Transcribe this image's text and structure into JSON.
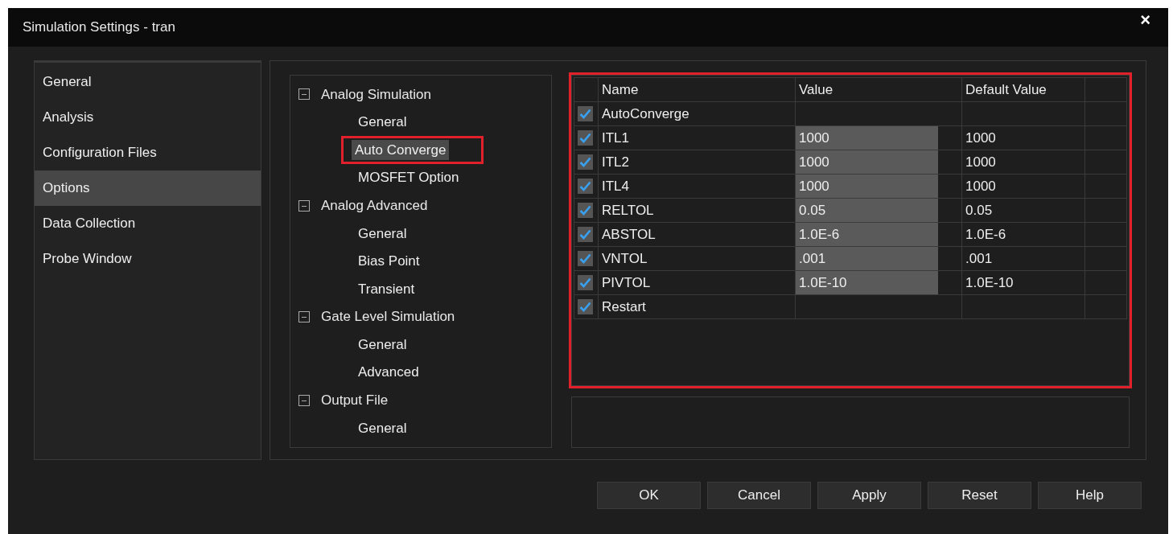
{
  "window": {
    "title": "Simulation Settings - tran",
    "close": "×"
  },
  "sidebar": {
    "items": [
      {
        "label": "General",
        "selected": false
      },
      {
        "label": "Analysis",
        "selected": false
      },
      {
        "label": "Configuration Files",
        "selected": false
      },
      {
        "label": "Options",
        "selected": true
      },
      {
        "label": "Data Collection",
        "selected": false
      },
      {
        "label": "Probe Window",
        "selected": false
      }
    ]
  },
  "tree": [
    {
      "label": "Analog Simulation",
      "expanded": true,
      "children": [
        {
          "label": "General",
          "selected": false,
          "highlighted": false
        },
        {
          "label": "Auto Converge",
          "selected": true,
          "highlighted": true
        },
        {
          "label": "MOSFET Option",
          "selected": false,
          "highlighted": false
        }
      ]
    },
    {
      "label": "Analog Advanced",
      "expanded": true,
      "children": [
        {
          "label": "General",
          "selected": false,
          "highlighted": false
        },
        {
          "label": "Bias Point",
          "selected": false,
          "highlighted": false
        },
        {
          "label": "Transient",
          "selected": false,
          "highlighted": false
        }
      ]
    },
    {
      "label": "Gate Level Simulation",
      "expanded": true,
      "children": [
        {
          "label": "General",
          "selected": false,
          "highlighted": false
        },
        {
          "label": "Advanced",
          "selected": false,
          "highlighted": false
        }
      ]
    },
    {
      "label": "Output File",
      "expanded": true,
      "children": [
        {
          "label": "General",
          "selected": false,
          "highlighted": false
        }
      ]
    }
  ],
  "table": {
    "highlighted": true,
    "columns": [
      "Name",
      "Value",
      "Default Value"
    ],
    "rows": [
      {
        "checked": true,
        "name": "AutoConverge"
      },
      {
        "checked": true,
        "name": "ITL1",
        "value": "1000",
        "default": "1000"
      },
      {
        "checked": true,
        "name": "ITL2",
        "value": "1000",
        "default": "1000"
      },
      {
        "checked": true,
        "name": "ITL4",
        "value": "1000",
        "default": "1000"
      },
      {
        "checked": true,
        "name": "RELTOL",
        "value": "0.05",
        "default": "0.05"
      },
      {
        "checked": true,
        "name": "ABSTOL",
        "value": "1.0E-6",
        "default": "1.0E-6"
      },
      {
        "checked": true,
        "name": "VNTOL",
        "value": ".001",
        "default": ".001"
      },
      {
        "checked": true,
        "name": "PIVTOL",
        "value": "1.0E-10",
        "default": "1.0E-10"
      },
      {
        "checked": true,
        "name": "Restart"
      }
    ]
  },
  "buttons": [
    "OK",
    "Cancel",
    "Apply",
    "Reset",
    "Help"
  ]
}
